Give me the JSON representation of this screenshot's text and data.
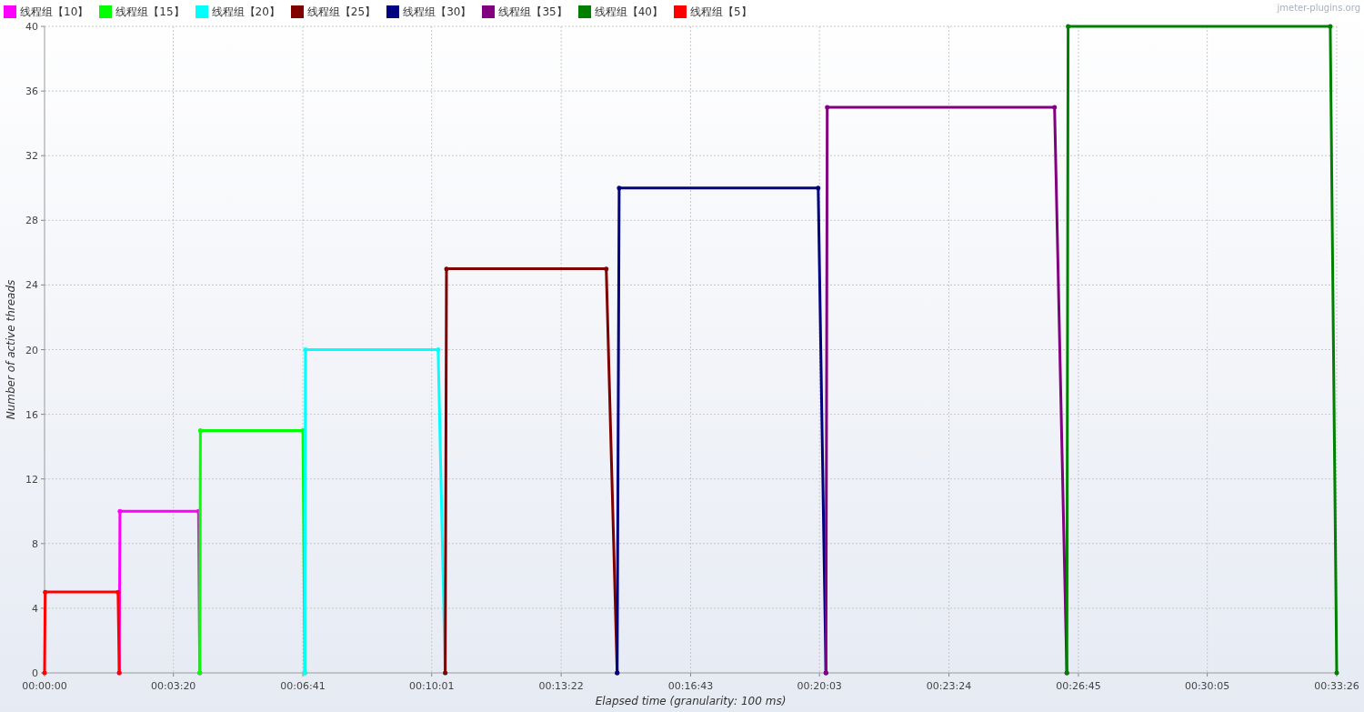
{
  "branding": "jmeter-plugins.org",
  "chart": {
    "chart_data": {
      "type": "line",
      "xlabel": "Elapsed time (granularity: 100 ms)",
      "ylabel": "Number of active threads",
      "x": [
        0,
        1,
        114,
        116,
        117,
        239,
        241,
        242,
        401,
        404,
        405,
        611,
        622,
        624,
        872,
        889,
        892,
        1201,
        1213,
        1215,
        1568,
        1587,
        1589,
        1996,
        2006
      ],
      "grid": true,
      "xlim": [
        0,
        2006
      ],
      "ylim": [
        0,
        40
      ],
      "xticks": [
        {
          "value": 0,
          "label": "00:00:00"
        },
        {
          "value": 200,
          "label": "00:03:20"
        },
        {
          "value": 401,
          "label": "00:06:41"
        },
        {
          "value": 601,
          "label": "00:10:01"
        },
        {
          "value": 802,
          "label": "00:13:22"
        },
        {
          "value": 1003,
          "label": "00:16:43"
        },
        {
          "value": 1203,
          "label": "00:20:03"
        },
        {
          "value": 1404,
          "label": "00:23:24"
        },
        {
          "value": 1605,
          "label": "00:26:45"
        },
        {
          "value": 1805,
          "label": "00:30:05"
        },
        {
          "value": 2006,
          "label": "00:33:26"
        }
      ],
      "yticks": [
        0,
        4,
        8,
        12,
        16,
        20,
        24,
        28,
        32,
        36,
        40
      ],
      "series": [
        {
          "name": "线程组【10】",
          "color": "#ff00ff",
          "values": [
            null,
            null,
            null,
            0,
            10,
            10,
            0,
            null,
            null,
            null,
            null,
            null,
            null,
            null,
            null,
            null,
            null,
            null,
            null,
            null,
            null,
            null,
            null,
            null,
            null
          ]
        },
        {
          "name": "线程组【15】",
          "color": "#00ff00",
          "values": [
            null,
            null,
            null,
            null,
            null,
            null,
            0,
            15,
            15,
            0,
            null,
            null,
            null,
            null,
            null,
            null,
            null,
            null,
            null,
            null,
            null,
            null,
            null,
            null,
            null
          ]
        },
        {
          "name": "线程组【20】",
          "color": "#00ffff",
          "values": [
            null,
            null,
            null,
            null,
            null,
            null,
            null,
            null,
            null,
            0,
            20,
            20,
            0,
            null,
            null,
            null,
            null,
            null,
            null,
            null,
            null,
            null,
            null,
            null,
            null
          ]
        },
        {
          "name": "线程组【25】",
          "color": "#800000",
          "values": [
            null,
            null,
            null,
            null,
            null,
            null,
            null,
            null,
            null,
            null,
            null,
            null,
            0,
            25,
            25,
            0,
            null,
            null,
            null,
            null,
            null,
            null,
            null,
            null,
            null
          ]
        },
        {
          "name": "线程组【30】",
          "color": "#000080",
          "values": [
            null,
            null,
            null,
            null,
            null,
            null,
            null,
            null,
            null,
            null,
            null,
            null,
            null,
            null,
            null,
            0,
            30,
            30,
            0,
            null,
            null,
            null,
            null,
            null,
            null
          ]
        },
        {
          "name": "线程组【35】",
          "color": "#800080",
          "values": [
            null,
            null,
            null,
            null,
            null,
            null,
            null,
            null,
            null,
            null,
            null,
            null,
            null,
            null,
            null,
            null,
            null,
            null,
            0,
            35,
            35,
            0,
            null,
            null,
            null
          ]
        },
        {
          "name": "线程组【40】",
          "color": "#008000",
          "values": [
            null,
            null,
            null,
            null,
            null,
            null,
            null,
            null,
            null,
            null,
            null,
            null,
            null,
            null,
            null,
            null,
            null,
            null,
            null,
            null,
            null,
            0,
            40,
            40,
            0
          ]
        },
        {
          "name": "线程组【5】",
          "color": "#ff0000",
          "values": [
            0,
            5,
            5,
            0,
            null,
            null,
            null,
            null,
            null,
            null,
            null,
            null,
            null,
            null,
            null,
            null,
            null,
            null,
            null,
            null,
            null,
            null,
            null,
            null,
            null
          ]
        }
      ]
    }
  }
}
